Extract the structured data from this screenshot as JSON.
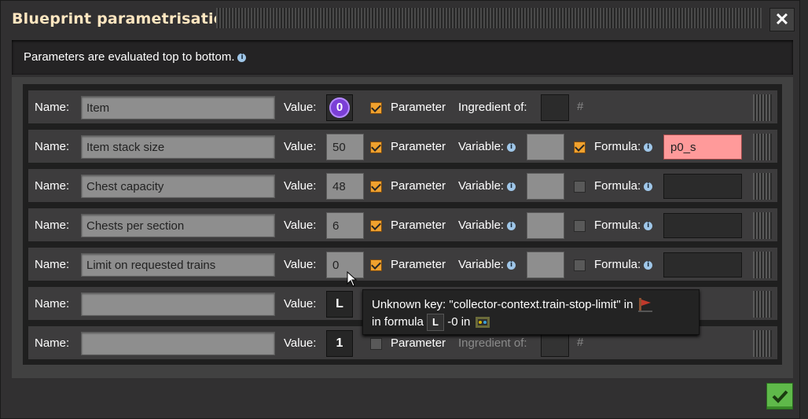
{
  "window": {
    "title": "Blueprint parametrisation",
    "close_label": "✕"
  },
  "info": {
    "text": "Parameters are evaluated top to bottom.",
    "info_icon": "i"
  },
  "labels": {
    "name": "Name:",
    "value": "Value:",
    "parameter": "Parameter",
    "ingredient_of": "Ingredient of:",
    "variable": "Variable:",
    "formula": "Formula:",
    "hash": "#",
    "info": "i"
  },
  "rows": [
    {
      "name": "Item",
      "value_icon": "0",
      "parameter_checked": true,
      "kind": "ingredient"
    },
    {
      "name": "Item stack size",
      "value": "50",
      "parameter_checked": true,
      "kind": "variable",
      "formula_checked": true,
      "formula": "p0_s",
      "formula_error": true
    },
    {
      "name": "Chest capacity",
      "value": "48",
      "parameter_checked": true,
      "kind": "variable",
      "formula_checked": false,
      "formula": ""
    },
    {
      "name": "Chests per section",
      "value": "6",
      "parameter_checked": true,
      "kind": "variable",
      "formula_checked": false,
      "formula": ""
    },
    {
      "name": "Limit on requested trains",
      "value": "0",
      "parameter_checked": true,
      "kind": "variable",
      "formula_checked": false,
      "formula": ""
    },
    {
      "name": "",
      "value_signal": "L",
      "kind": "hidden"
    },
    {
      "name": "",
      "value_signal": "1",
      "parameter_checked": false,
      "kind": "ingredient-dim"
    }
  ],
  "tooltip": {
    "line1": "Unknown key: \"collector-context.train-stop-limit\" in",
    "line2_prefix": "in formula",
    "line2_key": "L",
    "line2_suffix": "-0 in"
  },
  "colors": {
    "accent": "#f0a12e",
    "error": "#ff9a9a",
    "title": "#ffe6c0",
    "confirm": "#5fb94a"
  }
}
